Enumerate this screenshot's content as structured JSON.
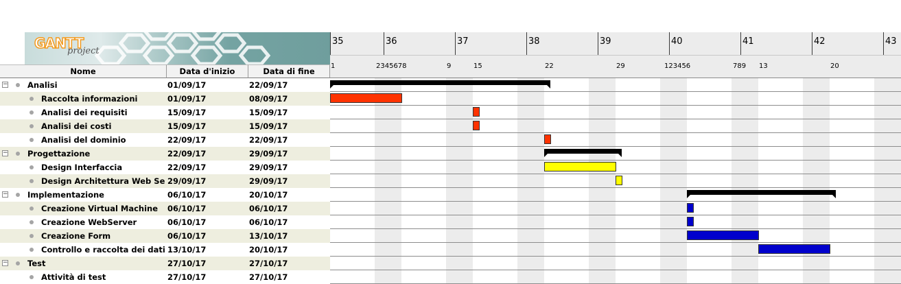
{
  "logo": {
    "text": "GANTT",
    "subtext": "project"
  },
  "columns": {
    "name": "Nome",
    "start": "Data d'inizio",
    "end": "Data di fine"
  },
  "tasks": [
    {
      "name": "Analisi",
      "start": "01/09/17",
      "end": "22/09/17",
      "level": 0,
      "expander": "−"
    },
    {
      "name": "Raccolta informazioni",
      "start": "01/09/17",
      "end": "08/09/17",
      "level": 1
    },
    {
      "name": "Analisi dei requisiti",
      "start": "15/09/17",
      "end": "15/09/17",
      "level": 1
    },
    {
      "name": "Analisi dei costi",
      "start": "15/09/17",
      "end": "15/09/17",
      "level": 1
    },
    {
      "name": "Analisi del dominio",
      "start": "22/09/17",
      "end": "22/09/17",
      "level": 1
    },
    {
      "name": "Progettazione",
      "start": "22/09/17",
      "end": "29/09/17",
      "level": 0,
      "expander": "−"
    },
    {
      "name": "Design Interfaccia",
      "start": "22/09/17",
      "end": "29/09/17",
      "level": 1
    },
    {
      "name": "Design Architettura Web Server",
      "start": "29/09/17",
      "end": "29/09/17",
      "level": 1
    },
    {
      "name": "Implementazione",
      "start": "06/10/17",
      "end": "20/10/17",
      "level": 0,
      "expander": "−"
    },
    {
      "name": "Creazione Virtual Machine",
      "start": "06/10/17",
      "end": "06/10/17",
      "level": 1
    },
    {
      "name": "Creazione WebServer",
      "start": "06/10/17",
      "end": "06/10/17",
      "level": 1
    },
    {
      "name": "Creazione Form",
      "start": "06/10/17",
      "end": "13/10/17",
      "level": 1
    },
    {
      "name": "Controllo e raccolta dei dati",
      "start": "13/10/17",
      "end": "20/10/17",
      "level": 1
    },
    {
      "name": "Test",
      "start": "27/10/17",
      "end": "27/10/17",
      "level": 0,
      "expander": "−"
    },
    {
      "name": "Attività di test",
      "start": "27/10/17",
      "end": "27/10/17",
      "level": 1
    }
  ],
  "timeline": {
    "weeks": [
      "35",
      "36",
      "37",
      "38",
      "39",
      "40",
      "41",
      "42",
      "43"
    ],
    "day_labels": [
      "1",
      "2345678",
      "9",
      "15",
      "22",
      "29",
      "123456",
      "789",
      "13",
      "20"
    ]
  },
  "chart_data": {
    "type": "gantt",
    "x_unit": "week number",
    "tasks": [
      {
        "name": "Analisi",
        "kind": "summary",
        "start": "01/09/17",
        "end": "22/09/17"
      },
      {
        "name": "Raccolta informazioni",
        "kind": "task",
        "color": "#ff3300",
        "start": "01/09/17",
        "end": "08/09/17"
      },
      {
        "name": "Analisi dei requisiti",
        "kind": "task",
        "color": "#ff3300",
        "start": "15/09/17",
        "end": "15/09/17"
      },
      {
        "name": "Analisi dei costi",
        "kind": "task",
        "color": "#ff3300",
        "start": "15/09/17",
        "end": "15/09/17"
      },
      {
        "name": "Analisi del dominio",
        "kind": "task",
        "color": "#ff3300",
        "start": "22/09/17",
        "end": "22/09/17"
      },
      {
        "name": "Progettazione",
        "kind": "summary",
        "start": "22/09/17",
        "end": "29/09/17"
      },
      {
        "name": "Design Interfaccia",
        "kind": "task",
        "color": "#ffff00",
        "start": "22/09/17",
        "end": "29/09/17"
      },
      {
        "name": "Design Architettura Web Server",
        "kind": "task",
        "color": "#ffff00",
        "start": "29/09/17",
        "end": "29/09/17"
      },
      {
        "name": "Implementazione",
        "kind": "summary",
        "start": "06/10/17",
        "end": "20/10/17"
      },
      {
        "name": "Creazione Virtual Machine",
        "kind": "task",
        "color": "#0000cc",
        "start": "06/10/17",
        "end": "06/10/17"
      },
      {
        "name": "Creazione WebServer",
        "kind": "task",
        "color": "#0000cc",
        "start": "06/10/17",
        "end": "06/10/17"
      },
      {
        "name": "Creazione Form",
        "kind": "task",
        "color": "#0000cc",
        "start": "06/10/17",
        "end": "13/10/17"
      },
      {
        "name": "Controllo e raccolta dei dati",
        "kind": "task",
        "color": "#0000cc",
        "start": "13/10/17",
        "end": "20/10/17"
      },
      {
        "name": "Test",
        "kind": "summary",
        "start": "27/10/17",
        "end": "27/10/17"
      },
      {
        "name": "Attività di test",
        "kind": "task",
        "color": "#0000cc",
        "start": "27/10/17",
        "end": "27/10/17"
      }
    ]
  }
}
